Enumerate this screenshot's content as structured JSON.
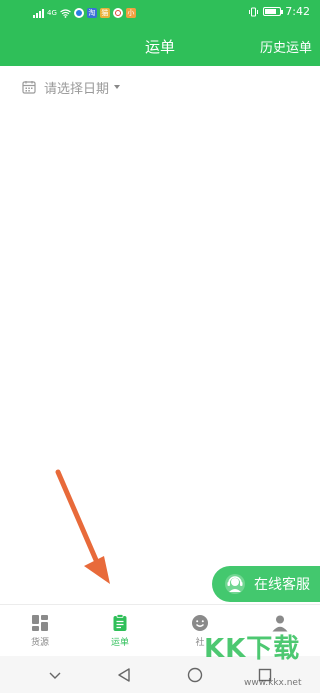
{
  "status_bar": {
    "time": "7:42",
    "signal": "4G",
    "battery_level": 0.75,
    "app_icons": [
      "app-icon-1",
      "app-icon-2",
      "app-icon-3",
      "app-icon-4",
      "app-icon-5"
    ]
  },
  "header": {
    "title": "运单",
    "history_label": "历史运单"
  },
  "filter": {
    "date_placeholder": "请选择日期"
  },
  "service": {
    "label": "在线客服"
  },
  "tabs": [
    {
      "label": "货源",
      "icon": "grid-icon",
      "active": false
    },
    {
      "label": "运单",
      "icon": "clipboard-icon",
      "active": true
    },
    {
      "label": "社",
      "icon": "smile-icon",
      "active": false
    },
    {
      "label": "",
      "icon": "person-icon",
      "active": false
    }
  ],
  "watermark": {
    "title": "KK下载",
    "url": "www.kkx.net"
  },
  "colors": {
    "brand": "#2fbf59",
    "arrow": "#e86a3a"
  }
}
